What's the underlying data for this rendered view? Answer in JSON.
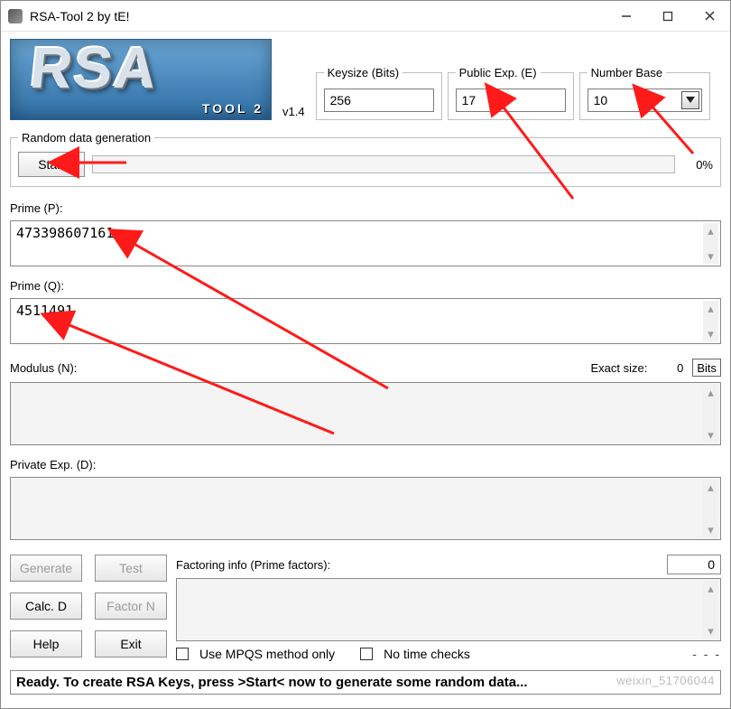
{
  "window": {
    "title": "RSA-Tool 2 by tE!"
  },
  "logo": {
    "big": "RSA",
    "sub": "TOOL 2"
  },
  "version": "v1.4",
  "top": {
    "keysize": {
      "legend": "Keysize (Bits)",
      "value": "256"
    },
    "pubexp": {
      "legend": "Public Exp. (E)",
      "value": "17"
    },
    "base": {
      "legend": "Number Base",
      "value": "10"
    }
  },
  "random": {
    "legend": "Random data generation",
    "start": "Start",
    "pct": "0%"
  },
  "labels": {
    "primeP": "Prime (P):",
    "primeQ": "Prime (Q):",
    "modulusN": "Modulus (N):",
    "exactSize": "Exact size:",
    "exactSizeVal": "0",
    "bits": "Bits",
    "privD": "Private Exp. (D):"
  },
  "values": {
    "primeP": "473398607161",
    "primeQ": "4511491",
    "modulusN": "",
    "privD": ""
  },
  "buttons": {
    "generate": "Generate",
    "test": "Test",
    "calcD": "Calc. D",
    "factorN": "Factor N",
    "help": "Help",
    "exit": "Exit"
  },
  "factor": {
    "label": "Factoring info (Prime factors):",
    "count": "0",
    "useMPQS": "Use MPQS method only",
    "noTime": "No time checks",
    "dash": "- - -"
  },
  "status": "Ready. To create RSA Keys, press >Start< now to generate some random data...",
  "watermark": "weixin_51706044"
}
